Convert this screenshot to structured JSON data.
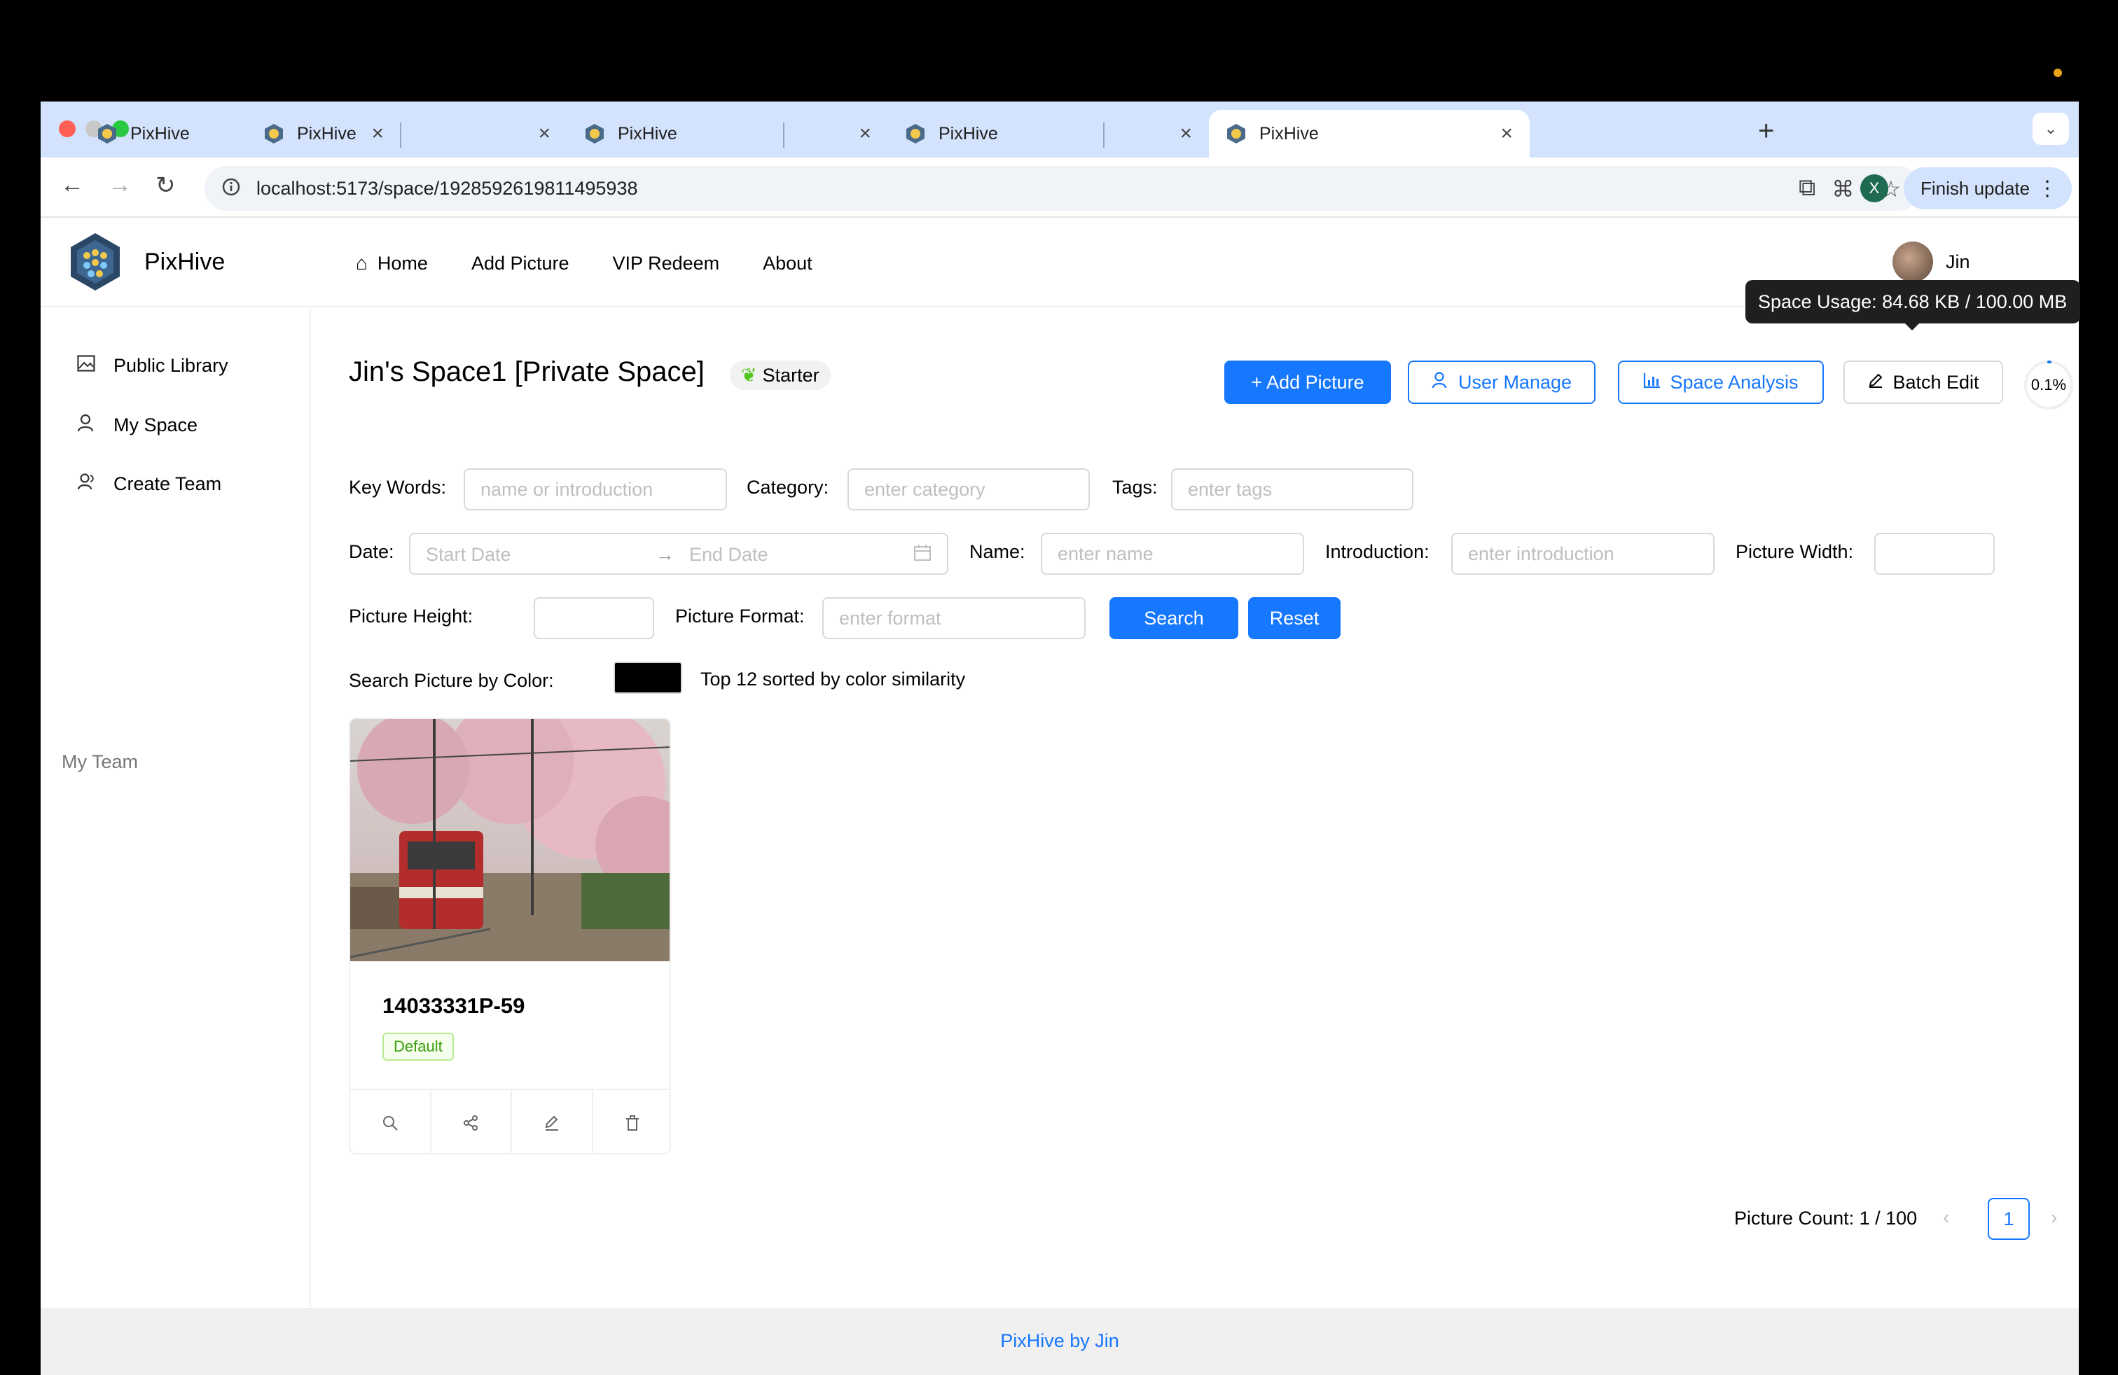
{
  "browser": {
    "tabs": [
      {
        "title": "PixHive"
      },
      {
        "title": "PixHive"
      },
      {
        "title": "PixHive"
      },
      {
        "title": "PixHive"
      },
      {
        "title": "PixHive"
      }
    ],
    "url": "localhost:5173/space/1928592619811495938",
    "profile_initial": "X",
    "finish_update": "Finish update"
  },
  "header": {
    "brand": "PixHive",
    "nav": [
      {
        "label": "Home"
      },
      {
        "label": "Add Picture"
      },
      {
        "label": "VIP Redeem"
      },
      {
        "label": "About"
      }
    ],
    "username": "Jin"
  },
  "sidebar": {
    "items": [
      {
        "label": "Public Library"
      },
      {
        "label": "My Space"
      },
      {
        "label": "Create Team"
      }
    ],
    "group_label": "My Team"
  },
  "space": {
    "title": "Jin's Space1 [Private Space]",
    "level": "Starter",
    "usage_percent_label": "0.1%",
    "usage_fraction": 0.001,
    "tooltip": "Space Usage: 84.68 KB / 100.00 MB"
  },
  "actions": {
    "add_picture": "+ Add Picture",
    "user_manage": "User Manage",
    "space_analysis": "Space Analysis",
    "batch_edit": "Batch Edit"
  },
  "filters": {
    "keywords_label": "Key Words",
    "keywords_placeholder": "name or introduction",
    "category_label": "Category",
    "category_placeholder": "enter category",
    "tags_label": "Tags",
    "tags_placeholder": "enter tags",
    "date_label": "Date",
    "start_date_placeholder": "Start Date",
    "end_date_placeholder": "End Date",
    "name_label": "Name",
    "name_placeholder": "enter name",
    "introduction_label": "Introduction",
    "introduction_placeholder": "enter introduction",
    "width_label": "Picture Width",
    "height_label": "Picture Height",
    "format_label": "Picture Format",
    "format_placeholder": "enter format",
    "search": "Search",
    "reset": "Reset",
    "color_label": "Search Picture by Color",
    "color_value": "#000000",
    "color_hint": "Top 12 sorted by color similarity"
  },
  "pictures": [
    {
      "name": "14033331P-59",
      "category": "Default"
    }
  ],
  "pagination": {
    "count_label": "Picture Count: 1 / 100",
    "current_page": "1"
  },
  "footer": {
    "text": "PixHive by Jin"
  },
  "colors": {
    "primary": "#1677ff",
    "tab_strip": "#d3e3fd"
  }
}
